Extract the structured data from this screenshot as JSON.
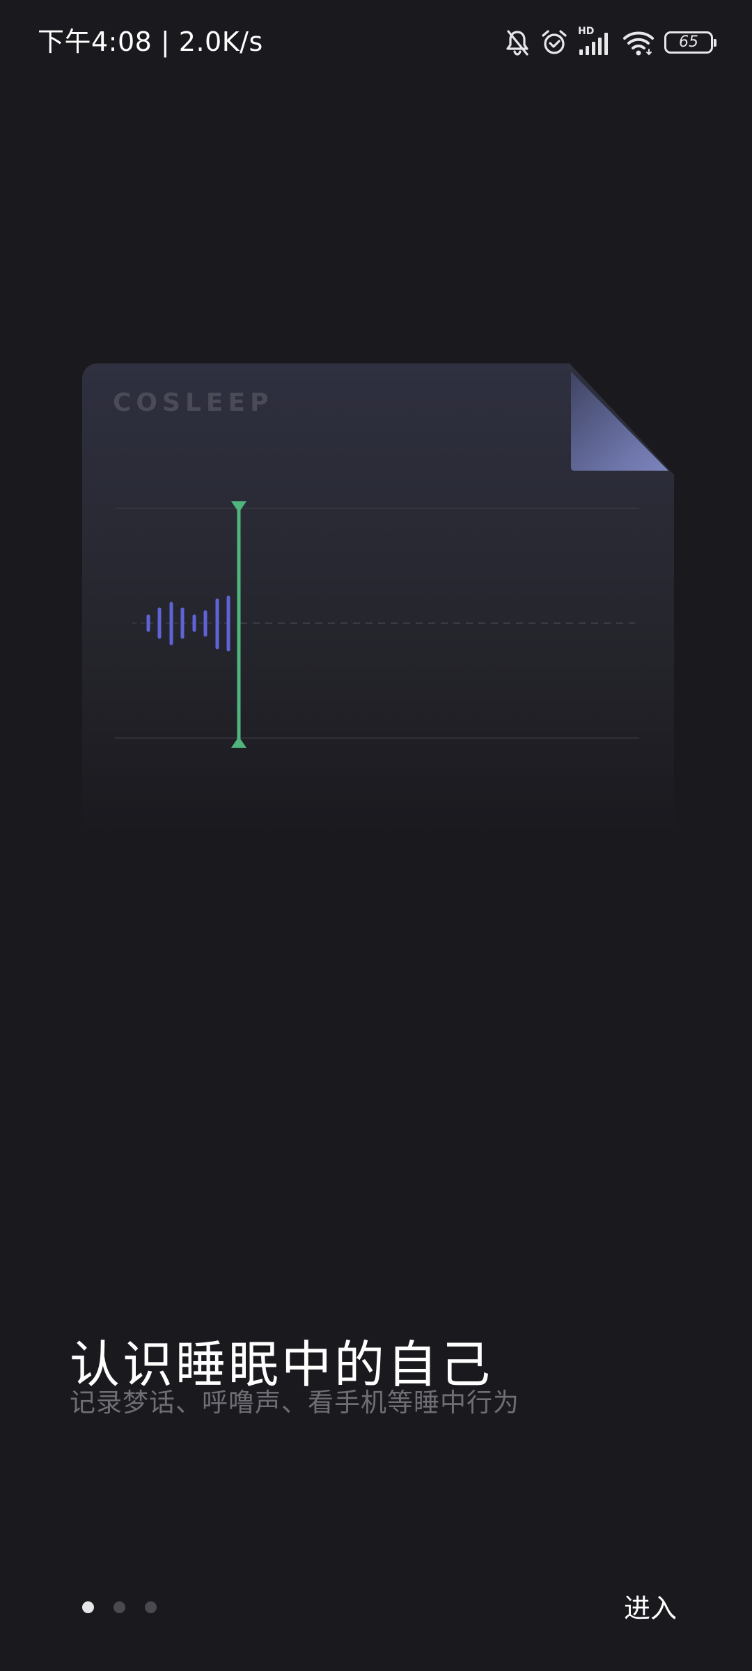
{
  "status_bar": {
    "time_text": "下午4:08 | 2.0K/s",
    "hd_label": "HD",
    "battery_level": "65"
  },
  "illustration": {
    "brand": "COSLEEP",
    "wave_color": "#5f63d6",
    "cursor_color": "#4fb57c"
  },
  "intro": {
    "title": "认识睡眠中的自己",
    "subtitle": "记录梦话、呼噜声、看手机等睡中行为"
  },
  "pagination": {
    "total": 3,
    "active": 1
  },
  "actions": {
    "enter_label": "进入"
  }
}
